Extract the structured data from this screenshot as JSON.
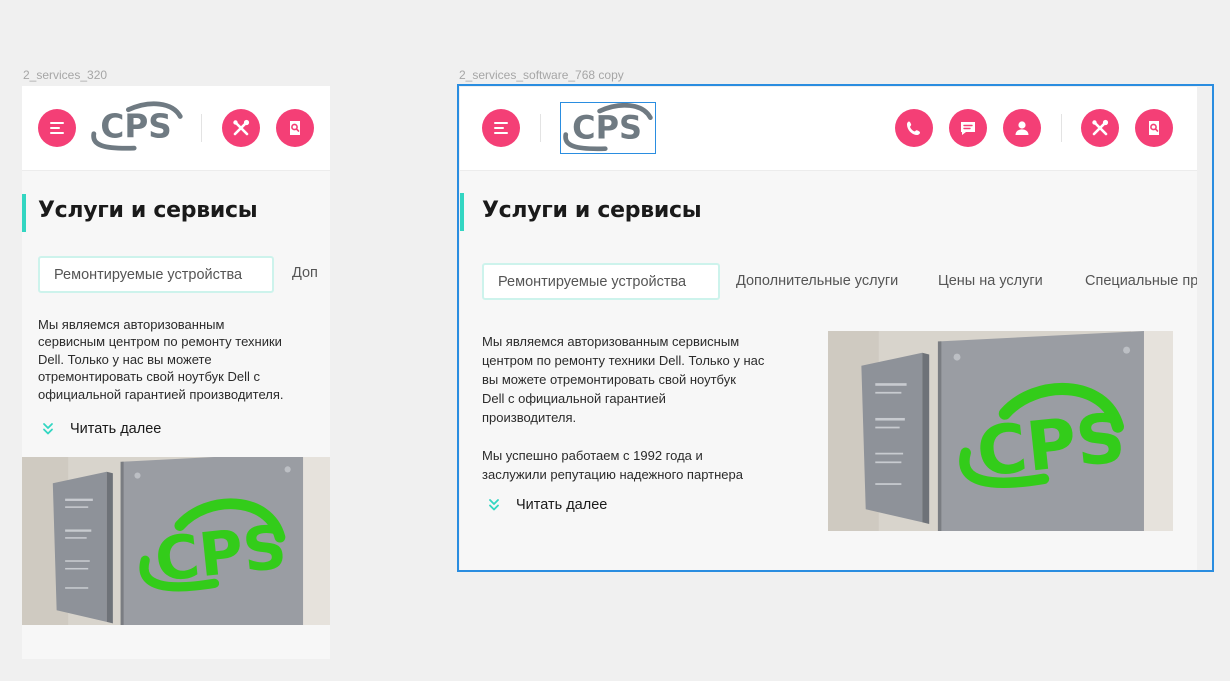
{
  "frames": {
    "mobile": {
      "label": "2_services_320"
    },
    "tablet": {
      "label": "2_services_software_768 copy"
    }
  },
  "brand": {
    "logo_text": "CPS",
    "accent": "#f43f76",
    "teal": "#33d6c2",
    "logo_gray": "#6f7a82",
    "sign_green": "#33cc1a"
  },
  "page": {
    "title": "Услуги и сервисы"
  },
  "tabs": [
    "Ремонтируемые устройства",
    "Дополнительные услуги",
    "Цены на услуги",
    "Специальные предложения"
  ],
  "mobile": {
    "tab_partial": "Доп",
    "text_lines": [
      "Мы являемся авторизованным",
      "сервисным центром по ремонту техники",
      "Dell. Только у нас вы можете",
      "отремонтировать свой ноутбук Dell с",
      "официальной гарантией производителя."
    ]
  },
  "tablet": {
    "tab4_partial": "Специальные пр",
    "paragraph1_lines": [
      "Мы являемся авторизованным сервисным",
      "центром по ремонту техники Dell. Только у нас",
      "вы можете отремонтировать свой ноутбук",
      "Dell с официальной гарантией",
      "производителя."
    ],
    "paragraph2_lines": [
      "Мы успешно работаем с 1992 года и",
      "заслужили репутацию надежного партнера"
    ]
  },
  "read_more": "Читать далее",
  "icons": {
    "menu": "menu-icon",
    "phone": "phone-icon",
    "chat": "chat-icon",
    "user": "user-icon",
    "tools": "tools-icon",
    "search_doc": "search-document-icon",
    "chevron": "double-chevron-down-icon"
  }
}
